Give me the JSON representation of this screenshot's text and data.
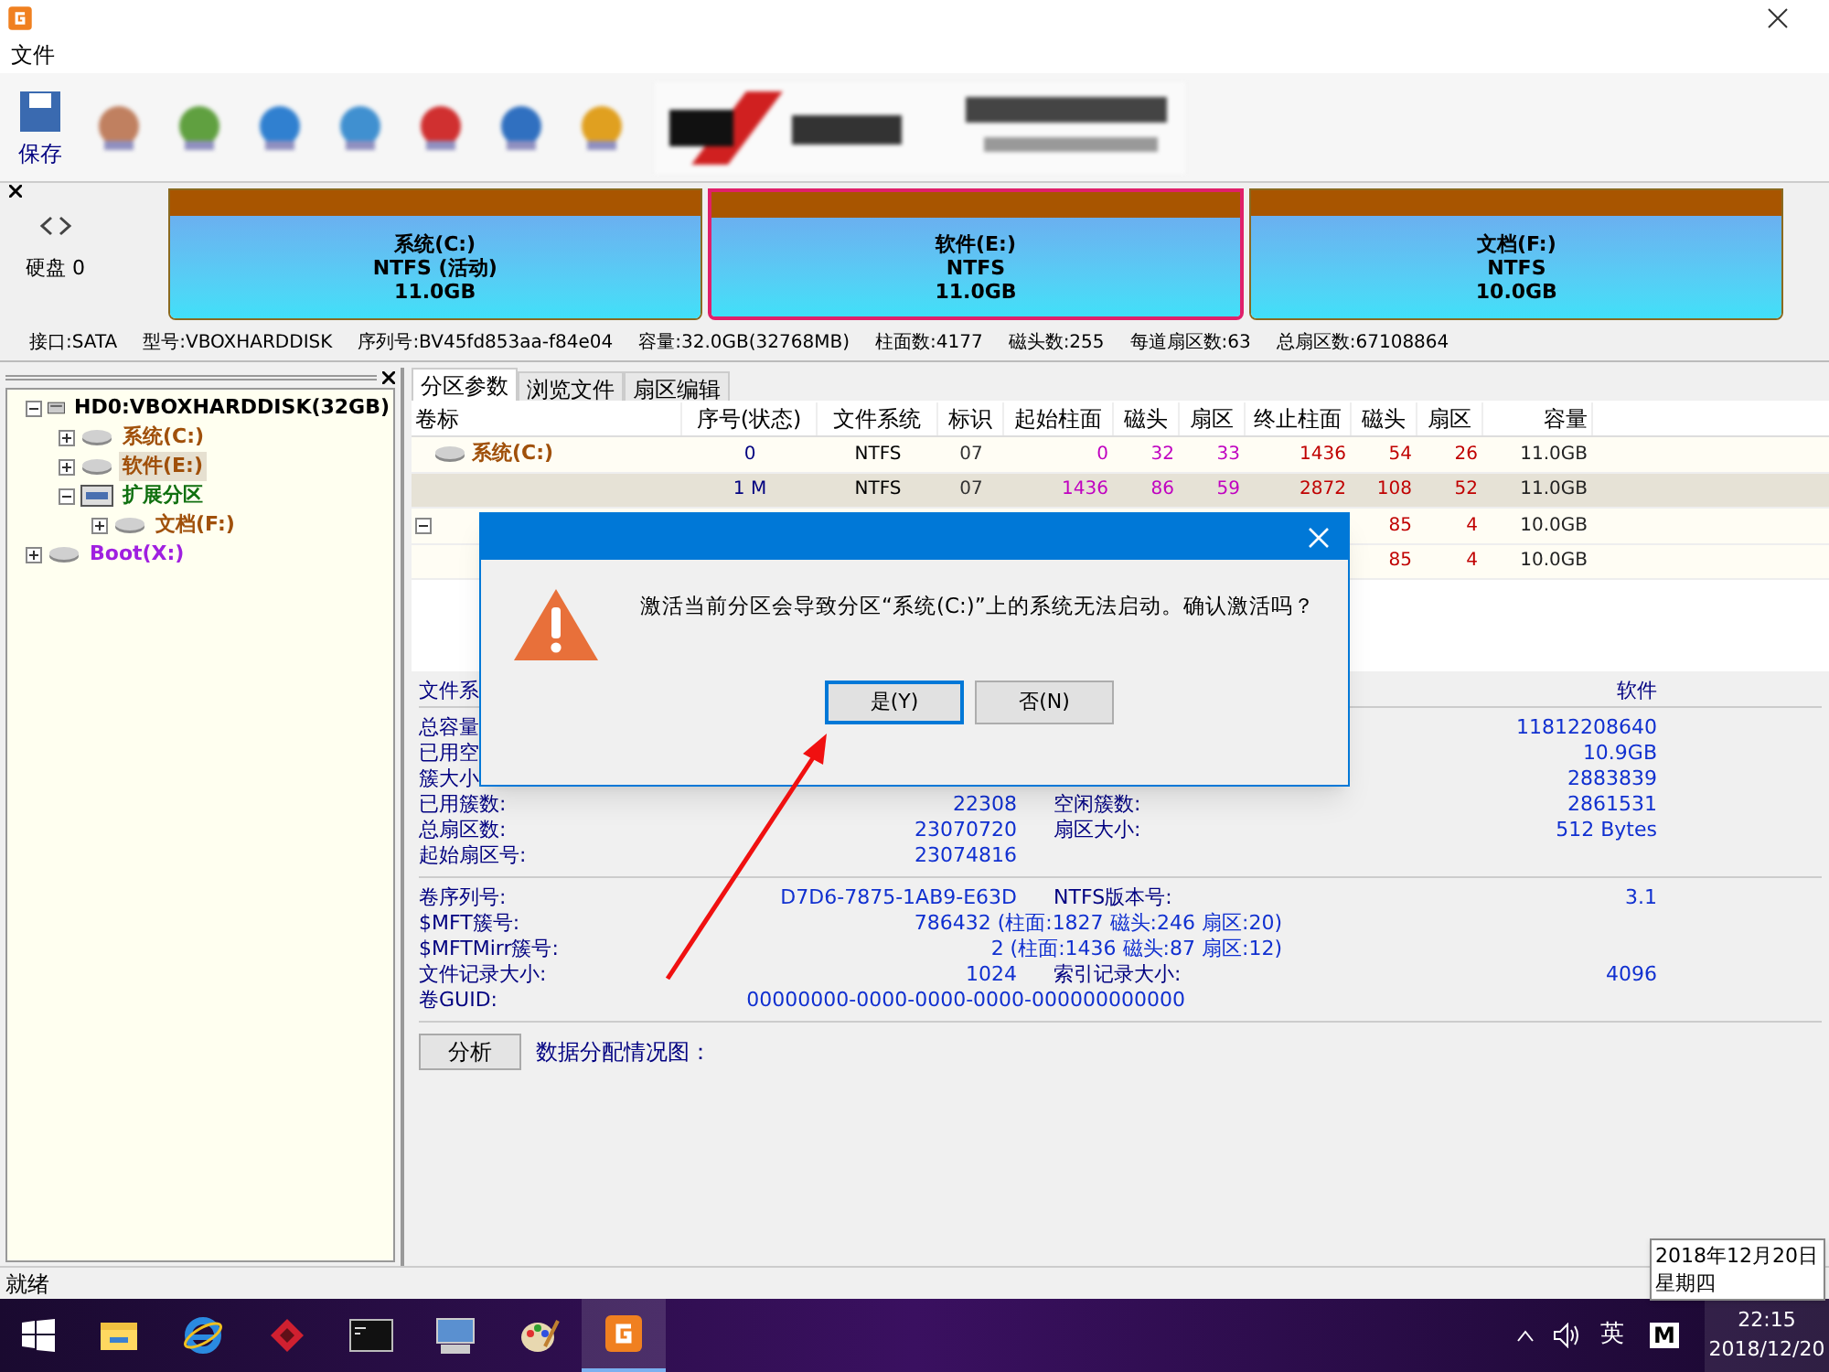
{
  "menu": [
    "文件"
  ],
  "toolbar": {
    "first_label": "保存"
  },
  "disk": {
    "label": "硬盘 0",
    "partitions": [
      {
        "name": "系统(C:)",
        "fs": "NTFS (活动)",
        "size": "11.0GB",
        "selected": false
      },
      {
        "name": "软件(E:)",
        "fs": "NTFS",
        "size": "11.0GB",
        "selected": true
      },
      {
        "name": "文档(F:)",
        "fs": "NTFS",
        "size": "10.0GB",
        "selected": false
      }
    ],
    "info": [
      "接口:SATA",
      "型号:VBOXHARDDISK",
      "序列号:BV45fd853aa-f84e04",
      "容量:32.0GB(32768MB)",
      "柱面数:4177",
      "磁头数:255",
      "每道扇区数:63",
      "总扇区数:67108864"
    ]
  },
  "tree": [
    {
      "label": "HD0:VBOXHARDDISK(32GB)",
      "kind": "disk",
      "color": "#000000",
      "expanded": true,
      "selected": false,
      "children": [
        {
          "label": "系统(C:)",
          "kind": "partition",
          "color": "#a0500a",
          "expanded": false,
          "selected": false
        },
        {
          "label": "软件(E:)",
          "kind": "partition",
          "color": "#a0500a",
          "expanded": false,
          "selected": true
        },
        {
          "label": "扩展分区",
          "kind": "extended",
          "color": "#107010",
          "expanded": true,
          "selected": false,
          "children": [
            {
              "label": "文档(F:)",
              "kind": "partition",
              "color": "#a0500a",
              "expanded": false,
              "selected": false
            }
          ]
        }
      ]
    },
    {
      "label": "Boot(X:)",
      "kind": "partition",
      "color": "#a020e0",
      "expanded": false,
      "selected": false
    }
  ],
  "tabs": [
    {
      "label": "分区参数",
      "selected": true
    },
    {
      "label": "浏览文件",
      "selected": false
    },
    {
      "label": "扇区编辑",
      "selected": false
    }
  ],
  "table": {
    "columns": [
      "卷标",
      "序号(状态)",
      "文件系统",
      "标识",
      "起始柱面",
      "磁头",
      "扇区",
      "终止柱面",
      "磁头",
      "扇区",
      "容量"
    ],
    "rows": [
      {
        "selected": false,
        "cells": [
          "系统(C:)",
          "0",
          "NTFS",
          "07",
          "0",
          "32",
          "33",
          "1436",
          "54",
          "26",
          "11.0GB"
        ]
      },
      {
        "selected": true,
        "cells": [
          null,
          "1 M",
          "NTFS",
          "07",
          "1436",
          "86",
          "59",
          "2872",
          "108",
          "52",
          "11.0GB"
        ]
      },
      {
        "selected": false,
        "expanded": true,
        "cells": [
          null,
          null,
          null,
          null,
          null,
          null,
          null,
          null,
          "85",
          "4",
          "10.0GB"
        ]
      },
      {
        "selected": false,
        "cells": [
          null,
          null,
          null,
          null,
          null,
          null,
          null,
          null,
          "85",
          "4",
          "10.0GB"
        ]
      }
    ]
  },
  "details": {
    "header": {
      "label": "文件系",
      "value": "软件"
    },
    "groups": [
      [
        {
          "label": "总容量",
          "value2": "11812208640"
        },
        {
          "label": "已用空",
          "value2": "10.9GB"
        },
        {
          "label": "簇大小",
          "value2": "2883839"
        },
        {
          "label": "已用簇数:",
          "value": "22308",
          "label2": "空闲簇数:",
          "value2": "2861531"
        },
        {
          "label": "总扇区数:",
          "value": "23070720",
          "label2": "扇区大小:",
          "value2": "512 Bytes"
        },
        {
          "label": "起始扇区号:",
          "value": "23074816"
        }
      ],
      [
        {
          "label": "卷序列号:",
          "value": "D7D6-7875-1AB9-E63D",
          "label2": "NTFS版本号:",
          "value2": "3.1"
        },
        {
          "label": "$MFT簇号:",
          "kind": "wide",
          "value": "786432 (柱面:1827 磁头:246 扇区:20)"
        },
        {
          "label": "$MFTMirr簇号:",
          "kind": "wide",
          "value": "2 (柱面:1436 磁头:87 扇区:12)"
        },
        {
          "label": "文件记录大小:",
          "value": "1024",
          "label2": "索引记录大小:",
          "value2": "4096"
        },
        {
          "label": "卷GUID:",
          "kind": "guid",
          "value": "00000000-0000-0000-0000-000000000000"
        }
      ]
    ],
    "analyze_button": "分析",
    "map_label": "数据分配情况图："
  },
  "dialog": {
    "message": "激活当前分区会导致分区“系统(C:)”上的系统无法启动。确认激活吗？",
    "buttons": [
      {
        "label": "是(Y)",
        "selected": true
      },
      {
        "label": "否(N)",
        "selected": false
      }
    ]
  },
  "status_bar": "就绪",
  "taskbar": {
    "apps": [
      {
        "kind": "folder",
        "selected": false
      },
      {
        "kind": "ie",
        "selected": false
      },
      {
        "kind": "diamond",
        "selected": false
      },
      {
        "kind": "terminal",
        "selected": false
      },
      {
        "kind": "computer",
        "selected": false
      },
      {
        "kind": "paint",
        "selected": false
      },
      {
        "kind": "diskgenius",
        "selected": true
      }
    ],
    "tray": {
      "ime": "英",
      "ime2": "M",
      "time": "22:15",
      "date": "2018/12/20"
    },
    "tooltip": [
      "2018年12月20日",
      "星期四"
    ]
  }
}
